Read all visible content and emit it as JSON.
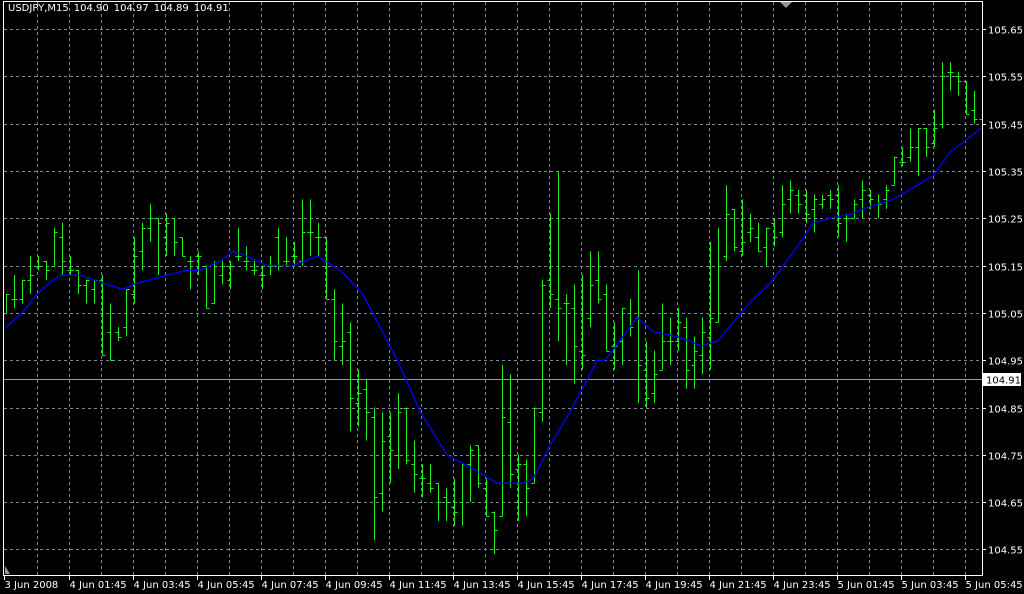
{
  "header": {
    "symbol": "USDJPY,M15",
    "open": "104.90",
    "high": "104.97",
    "low": "104.89",
    "close": "104.91"
  },
  "colors": {
    "background": "#000000",
    "grid": "#778899",
    "bars": "#22ee22",
    "ma_line": "#0000ff",
    "axis": "#ffffff",
    "bid_line": "#8c9aa8"
  },
  "chart_data": {
    "type": "ohlc",
    "title": "USDJPY,M15",
    "current_price": 104.91,
    "current_price_label": "104.91",
    "ylim": [
      104.53,
      105.67
    ],
    "y_ticks": [
      105.65,
      105.55,
      105.45,
      105.35,
      105.25,
      105.15,
      105.05,
      104.95,
      104.85,
      104.75,
      104.65,
      104.55
    ],
    "y_tick_labels": [
      "105.65",
      "105.55",
      "105.45",
      "105.35",
      "105.25",
      "105.15",
      "105.05",
      "104.95",
      "104.85",
      "104.75",
      "104.65",
      "104.55"
    ],
    "x_tick_labels": [
      "3 Jun 2008",
      "4 Jun 01:45",
      "4 Jun 03:45",
      "4 Jun 05:45",
      "4 Jun 07:45",
      "4 Jun 09:45",
      "4 Jun 11:45",
      "4 Jun 13:45",
      "4 Jun 15:45",
      "4 Jun 17:45",
      "4 Jun 19:45",
      "4 Jun 21:45",
      "4 Jun 23:45",
      "5 Jun 01:45",
      "5 Jun 03:45",
      "5 Jun 05:45"
    ],
    "bars_per_x_label": 8,
    "bars_ohlc": [
      [
        105.05,
        105.09,
        105.05,
        105.09
      ],
      [
        105.08,
        105.13,
        105.06,
        105.08
      ],
      [
        105.08,
        105.12,
        105.07,
        105.12
      ],
      [
        105.12,
        105.17,
        105.09,
        105.13
      ],
      [
        105.15,
        105.17,
        105.14,
        105.15
      ],
      [
        105.16,
        105.16,
        105.12,
        105.14
      ],
      [
        105.15,
        105.23,
        105.15,
        105.22
      ],
      [
        105.21,
        105.24,
        105.13,
        105.16
      ],
      [
        105.14,
        105.17,
        105.13,
        105.14
      ],
      [
        105.14,
        105.14,
        105.09,
        105.11
      ],
      [
        105.11,
        105.12,
        105.07,
        105.12
      ],
      [
        105.1,
        105.12,
        105.07,
        105.12
      ],
      [
        105.12,
        105.13,
        104.96,
        104.96
      ],
      [
        105.01,
        105.07,
        104.95,
        104.95
      ],
      [
        105.01,
        105.02,
        104.99,
        105.0
      ],
      [
        105.02,
        105.1,
        105.0,
        105.1
      ],
      [
        105.09,
        105.21,
        105.07,
        105.17
      ],
      [
        105.18,
        105.24,
        105.14,
        105.23
      ],
      [
        105.23,
        105.28,
        105.2,
        105.25
      ],
      [
        105.25,
        105.25,
        105.13,
        105.24
      ],
      [
        105.21,
        105.26,
        105.17,
        105.24
      ],
      [
        105.25,
        105.25,
        105.17,
        105.2
      ],
      [
        105.21,
        105.21,
        105.17,
        105.17
      ],
      [
        105.16,
        105.17,
        105.1,
        105.16
      ],
      [
        105.17,
        105.18,
        105.13,
        105.17
      ],
      [
        105.15,
        105.15,
        105.06,
        105.06
      ],
      [
        105.07,
        105.16,
        105.07,
        105.15
      ],
      [
        105.13,
        105.16,
        105.11,
        105.15
      ],
      [
        105.12,
        105.16,
        105.1,
        105.15
      ],
      [
        105.17,
        105.23,
        105.16,
        105.17
      ],
      [
        105.16,
        105.19,
        105.14,
        105.16
      ],
      [
        105.14,
        105.16,
        105.13,
        105.14
      ],
      [
        105.13,
        105.15,
        105.1,
        105.13
      ],
      [
        105.15,
        105.17,
        105.13,
        105.15
      ],
      [
        105.21,
        105.23,
        105.14,
        105.15
      ],
      [
        105.16,
        105.21,
        105.15,
        105.16
      ],
      [
        105.17,
        105.2,
        105.15,
        105.17
      ],
      [
        105.16,
        105.29,
        105.15,
        105.22
      ],
      [
        105.22,
        105.29,
        105.17,
        105.22
      ],
      [
        105.21,
        105.24,
        105.17,
        105.21
      ],
      [
        105.21,
        105.21,
        105.08,
        105.08
      ],
      [
        105.08,
        105.1,
        104.95,
        104.99
      ],
      [
        104.98,
        105.07,
        104.94,
        104.99
      ],
      [
        105.01,
        105.03,
        104.8,
        104.87
      ],
      [
        104.86,
        104.93,
        104.81,
        104.88
      ],
      [
        104.89,
        104.91,
        104.78,
        104.84
      ],
      [
        104.83,
        104.85,
        104.57,
        104.66
      ],
      [
        104.67,
        104.84,
        104.63,
        104.78
      ],
      [
        104.79,
        104.84,
        104.69,
        104.76
      ],
      [
        104.75,
        104.88,
        104.72,
        104.84
      ],
      [
        104.85,
        104.85,
        104.73,
        104.74
      ],
      [
        104.73,
        104.78,
        104.67,
        104.71
      ],
      [
        104.7,
        104.73,
        104.66,
        104.7
      ],
      [
        104.69,
        104.73,
        104.67,
        104.68
      ],
      [
        104.69,
        104.69,
        104.61,
        104.65
      ],
      [
        104.66,
        104.68,
        104.61,
        104.65
      ],
      [
        104.64,
        104.7,
        104.6,
        104.63
      ],
      [
        104.65,
        104.73,
        104.6,
        104.73
      ],
      [
        104.73,
        104.77,
        104.65,
        104.76
      ],
      [
        104.77,
        104.77,
        104.68,
        104.69
      ],
      [
        104.68,
        104.7,
        104.62,
        104.62
      ],
      [
        104.63,
        104.63,
        104.54,
        104.59
      ],
      [
        104.62,
        104.94,
        104.62,
        104.83
      ],
      [
        104.82,
        104.92,
        104.68,
        104.71
      ],
      [
        104.72,
        104.75,
        104.61,
        104.73
      ],
      [
        104.73,
        104.74,
        104.62,
        104.68
      ],
      [
        104.69,
        104.85,
        104.69,
        104.85
      ],
      [
        104.84,
        105.12,
        104.82,
        105.11
      ],
      [
        105.12,
        105.26,
        105.06,
        105.09
      ],
      [
        105.08,
        105.35,
        104.99,
        105.06
      ],
      [
        105.07,
        105.09,
        104.94,
        105.07
      ],
      [
        105.06,
        105.11,
        104.9,
        104.98
      ],
      [
        104.97,
        105.13,
        104.93,
        104.96
      ],
      [
        105.04,
        105.18,
        105.02,
        105.11
      ],
      [
        105.12,
        105.18,
        105.07,
        105.08
      ],
      [
        105.09,
        105.11,
        104.97,
        104.97
      ],
      [
        104.98,
        105.03,
        104.93,
        104.98
      ],
      [
        104.99,
        105.06,
        104.94,
        105.06
      ],
      [
        105.05,
        105.08,
        105.0,
        105.02
      ],
      [
        105.04,
        105.14,
        104.86,
        104.94
      ],
      [
        104.93,
        104.99,
        104.85,
        104.87
      ],
      [
        104.88,
        104.97,
        104.86,
        104.92
      ],
      [
        104.93,
        105.07,
        104.93,
        104.99
      ],
      [
        104.99,
        105.04,
        104.94,
        104.99
      ],
      [
        104.99,
        105.06,
        104.97,
        105.03
      ],
      [
        105.02,
        105.04,
        104.89,
        104.93
      ],
      [
        104.94,
        105.0,
        104.89,
        104.97
      ],
      [
        104.96,
        105.04,
        104.92,
        105.01
      ],
      [
        105.0,
        105.2,
        104.93,
        105.04
      ],
      [
        105.03,
        105.23,
        105.03,
        105.15
      ],
      [
        105.17,
        105.32,
        105.16,
        105.26
      ],
      [
        105.27,
        105.27,
        105.18,
        105.19
      ],
      [
        105.18,
        105.29,
        105.17,
        105.2
      ],
      [
        105.22,
        105.26,
        105.2,
        105.23
      ],
      [
        105.21,
        105.24,
        105.18,
        105.18
      ],
      [
        105.19,
        105.23,
        105.15,
        105.23
      ],
      [
        105.24,
        105.25,
        105.19,
        105.21
      ],
      [
        105.22,
        105.32,
        105.21,
        105.28
      ],
      [
        105.29,
        105.33,
        105.26,
        105.31
      ],
      [
        105.3,
        105.31,
        105.26,
        105.28
      ],
      [
        105.3,
        105.31,
        105.24,
        105.26
      ],
      [
        105.27,
        105.3,
        105.22,
        105.29
      ],
      [
        105.28,
        105.3,
        105.27,
        105.29
      ],
      [
        105.3,
        105.31,
        105.27,
        105.29
      ],
      [
        105.3,
        105.32,
        105.21,
        105.24
      ],
      [
        105.25,
        105.26,
        105.2,
        105.25
      ],
      [
        105.25,
        105.29,
        105.25,
        105.28
      ],
      [
        105.29,
        105.33,
        105.25,
        105.31
      ],
      [
        105.3,
        105.31,
        105.27,
        105.29
      ],
      [
        105.28,
        105.3,
        105.25,
        105.28
      ],
      [
        105.29,
        105.32,
        105.27,
        105.31
      ],
      [
        105.32,
        105.38,
        105.32,
        105.38
      ],
      [
        105.37,
        105.4,
        105.36,
        105.37
      ],
      [
        105.38,
        105.44,
        105.37,
        105.4
      ],
      [
        105.4,
        105.44,
        105.34,
        105.44
      ],
      [
        105.44,
        105.44,
        105.38,
        105.4
      ],
      [
        105.41,
        105.48,
        105.4,
        105.44
      ],
      [
        105.45,
        105.58,
        105.44,
        105.55
      ],
      [
        105.56,
        105.58,
        105.52,
        105.56
      ],
      [
        105.55,
        105.56,
        105.51,
        105.54
      ],
      [
        105.54,
        105.54,
        105.47,
        105.47
      ],
      [
        105.48,
        105.52,
        105.45,
        105.46
      ],
      [
        105.46,
        105.48,
        105.42,
        105.45
      ]
    ],
    "moving_average": [
      [
        1,
        105.02
      ],
      [
        3,
        105.05
      ],
      [
        4.9,
        105.09
      ],
      [
        6.9,
        105.12
      ],
      [
        7.9,
        105.13
      ],
      [
        10.3,
        105.13
      ],
      [
        11.9,
        105.12
      ],
      [
        13.6,
        105.11
      ],
      [
        15.6,
        105.1
      ],
      [
        16.9,
        105.11
      ],
      [
        19,
        105.12
      ],
      [
        21.1,
        105.13
      ],
      [
        23.6,
        105.14
      ],
      [
        25.3,
        105.14
      ],
      [
        27.8,
        105.16
      ],
      [
        29.4,
        105.18
      ],
      [
        31.1,
        105.17
      ],
      [
        33.6,
        105.15
      ],
      [
        36.9,
        105.15
      ],
      [
        39.9,
        105.17
      ],
      [
        42.8,
        105.14
      ],
      [
        45.6,
        105.09
      ],
      [
        49.9,
        104.95
      ],
      [
        52.8,
        104.84
      ],
      [
        56.1,
        104.75
      ],
      [
        59.4,
        104.72
      ],
      [
        62.4,
        104.69
      ],
      [
        65.6,
        104.69
      ],
      [
        66.9,
        104.7
      ],
      [
        69,
        104.77
      ],
      [
        71.5,
        104.84
      ],
      [
        74.9,
        104.95
      ],
      [
        75.9,
        104.95
      ],
      [
        79.9,
        105.04
      ],
      [
        81.9,
        105.01
      ],
      [
        84.9,
        105.0
      ],
      [
        87.9,
        104.98
      ],
      [
        89.9,
        104.99
      ],
      [
        91.9,
        105.03
      ],
      [
        93.9,
        105.07
      ],
      [
        96.9,
        105.12
      ],
      [
        100.3,
        105.2
      ],
      [
        101.9,
        105.24
      ],
      [
        104,
        105.25
      ],
      [
        106.9,
        105.26
      ],
      [
        108.1,
        105.27
      ],
      [
        111.9,
        105.29
      ],
      [
        112.9,
        105.3
      ],
      [
        116.9,
        105.34
      ],
      [
        119,
        105.39
      ],
      [
        120.6,
        105.41
      ],
      [
        122.9,
        105.44
      ]
    ]
  }
}
